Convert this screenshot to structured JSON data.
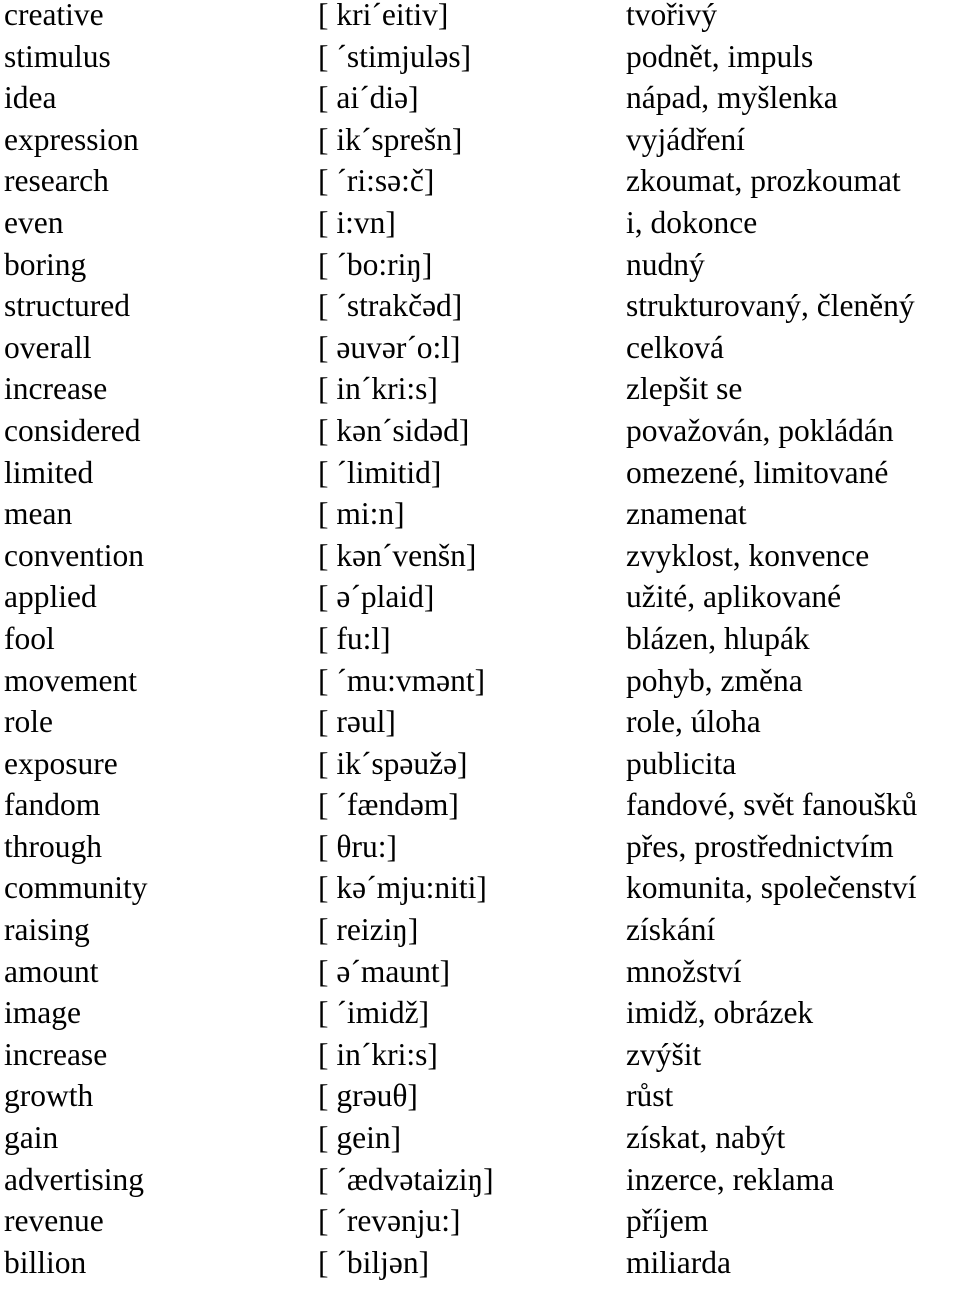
{
  "vocabulary": [
    {
      "english": "creative",
      "pronunciation": "[ kri´eitiv]",
      "czech": "tvořivý"
    },
    {
      "english": "stimulus",
      "pronunciation": "[ ´stimjuləs]",
      "czech": "podnět, impuls"
    },
    {
      "english": "idea",
      "pronunciation": "[ ai´diə]",
      "czech": "nápad, myšlenka"
    },
    {
      "english": "expression",
      "pronunciation": "[ ik´sprešn]",
      "czech": "vyjádření"
    },
    {
      "english": "research",
      "pronunciation": "[ ´ri:sə:č]",
      "czech": "zkoumat, prozkoumat"
    },
    {
      "english": "even",
      "pronunciation": "[ i:vn]",
      "czech": "i, dokonce"
    },
    {
      "english": "boring",
      "pronunciation": "[ ´bo:riŋ]",
      "czech": "nudný"
    },
    {
      "english": "structured",
      "pronunciation": "[ ´strakčəd]",
      "czech": "strukturovaný, členěný"
    },
    {
      "english": "overall",
      "pronunciation": "[ əuvər´o:l]",
      "czech": "celková"
    },
    {
      "english": "increase",
      "pronunciation": "[ in´kri:s]",
      "czech": "zlepšit se"
    },
    {
      "english": "considered",
      "pronunciation": "[ kən´sidəd]",
      "czech": "považován, pokládán"
    },
    {
      "english": "limited",
      "pronunciation": "[ ´limitid]",
      "czech": "omezené, limitované"
    },
    {
      "english": "mean",
      "pronunciation": "[ mi:n]",
      "czech": "znamenat"
    },
    {
      "english": "convention",
      "pronunciation": "[ kən´venšn]",
      "czech": "zvyklost, konvence"
    },
    {
      "english": "applied",
      "pronunciation": "[ ə´plaid]",
      "czech": "užité, aplikované"
    },
    {
      "english": "fool",
      "pronunciation": "[ fu:l]",
      "czech": "blázen, hlupák"
    },
    {
      "english": "movement",
      "pronunciation": "[ ´mu:vmənt]",
      "czech": "pohyb, změna"
    },
    {
      "english": "role",
      "pronunciation": "[ rəul]",
      "czech": "role, úloha"
    },
    {
      "english": "exposure",
      "pronunciation": "[ ik´spəužə]",
      "czech": "publicita"
    },
    {
      "english": "fandom",
      "pronunciation": "[ ´fændəm]",
      "czech": "fandové, svět fanoušků"
    },
    {
      "english": "through",
      "pronunciation": "[ θru:]",
      "czech": "přes, prostřednictvím"
    },
    {
      "english": "community",
      "pronunciation": "[ kə´mju:niti]",
      "czech": "komunita, společenství"
    },
    {
      "english": "raising",
      "pronunciation": "[ reiziŋ]",
      "czech": "získání"
    },
    {
      "english": "amount",
      "pronunciation": "[ ə´maunt]",
      "czech": "množství"
    },
    {
      "english": "image",
      "pronunciation": "[ ´imidž]",
      "czech": "imidž, obrázek"
    },
    {
      "english": "increase",
      "pronunciation": "[ in´kri:s]",
      "czech": "zvýšit"
    },
    {
      "english": "growth",
      "pronunciation": "[ grəuθ]",
      "czech": "růst"
    },
    {
      "english": "gain",
      "pronunciation": "[ gein]",
      "czech": "získat, nabýt"
    },
    {
      "english": "advertising",
      "pronunciation": "[ ´ædvətaiziŋ]",
      "czech": "inzerce, reklama"
    },
    {
      "english": "revenue",
      "pronunciation": "[ ´revənju:]",
      "czech": "příjem"
    },
    {
      "english": "billion",
      "pronunciation": "[ ´biljən]",
      "czech": "miliarda"
    }
  ]
}
